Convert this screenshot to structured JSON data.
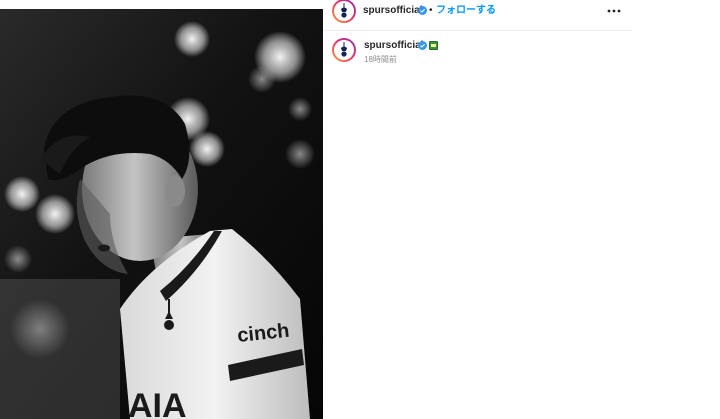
{
  "post": {
    "account": {
      "username": "spursofficial",
      "verified_icon": "verified-badge-icon",
      "avatar_icon": "spurs-cockerel-logo-icon"
    },
    "header": {
      "separator": "•",
      "follow_label": "フォローする",
      "more_icon": "more-options-icon"
    },
    "caption": {
      "username": "spursofficial",
      "emoji_icon": "emoji-icon",
      "timestamp": "18時間前"
    },
    "image": {
      "alt_subject": "player-photo",
      "jersey_text": "cinch"
    },
    "colors": {
      "follow_blue": "#0095f6",
      "verified_blue": "#3897f0",
      "muted_text": "#8e8e8e",
      "divider": "#efefef"
    }
  }
}
